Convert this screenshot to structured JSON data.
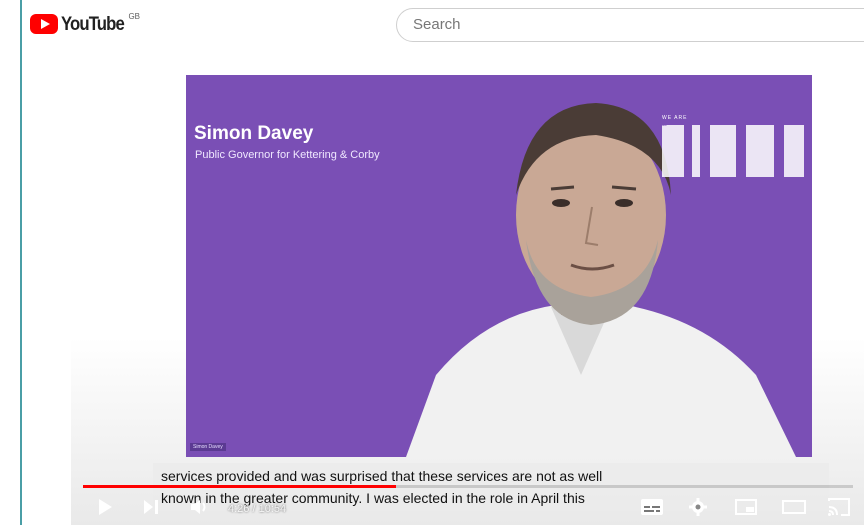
{
  "header": {
    "logo_text": "YouTube",
    "region": "GB",
    "search_placeholder": "Search"
  },
  "video": {
    "slide_name": "Simon Davey",
    "slide_role": "Public Governor for Kettering & Corby",
    "brand_small": "WE ARE",
    "brand_large": "NHFT",
    "lower_third": "Simon Davey",
    "caption_lines": [
      "services provided and was surprised that these services are not as well",
      "known in the greater community. I was elected in the role in April this"
    ]
  },
  "player": {
    "time_text": "4:26 / 10:54",
    "progress_fraction": 0.407,
    "icons": [
      "play-icon",
      "next-icon",
      "volume-icon",
      "subtitles-icon",
      "settings-icon",
      "miniplayer-icon",
      "theater-icon",
      "cast-icon"
    ]
  },
  "colors": {
    "brand_red": "#ff0000",
    "slide_purple": "#7a4fb5"
  }
}
